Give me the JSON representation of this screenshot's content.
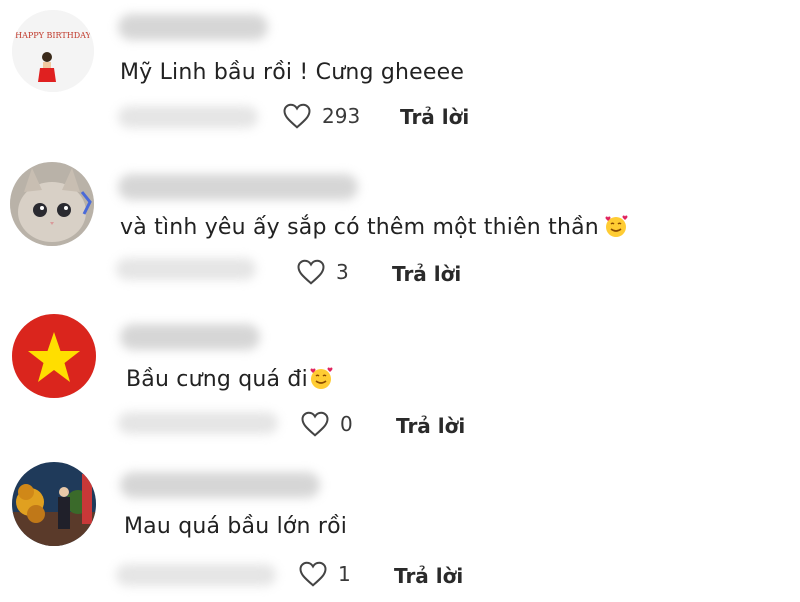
{
  "comments": [
    {
      "text": "Mỹ Linh bầu rồi ! Cưng gheeee",
      "emoji": false,
      "likes": "293",
      "reply": "Trả lời",
      "avatar_text": "HAPPY BIRTHDAY"
    },
    {
      "text": "và tình yêu ấy sắp có thêm một thiên thần",
      "emoji": true,
      "likes": "3",
      "reply": "Trả lời"
    },
    {
      "text": "Bầu cưng quá đi",
      "emoji": true,
      "likes": "0",
      "reply": "Trả lời"
    },
    {
      "text": "Mau quá bầu lớn rồi",
      "emoji": false,
      "likes": "1",
      "reply": "Trả lời"
    }
  ],
  "colors": {
    "flag_red": "#da251d",
    "flag_star": "#ffde00",
    "heart_stroke": "#444444"
  }
}
